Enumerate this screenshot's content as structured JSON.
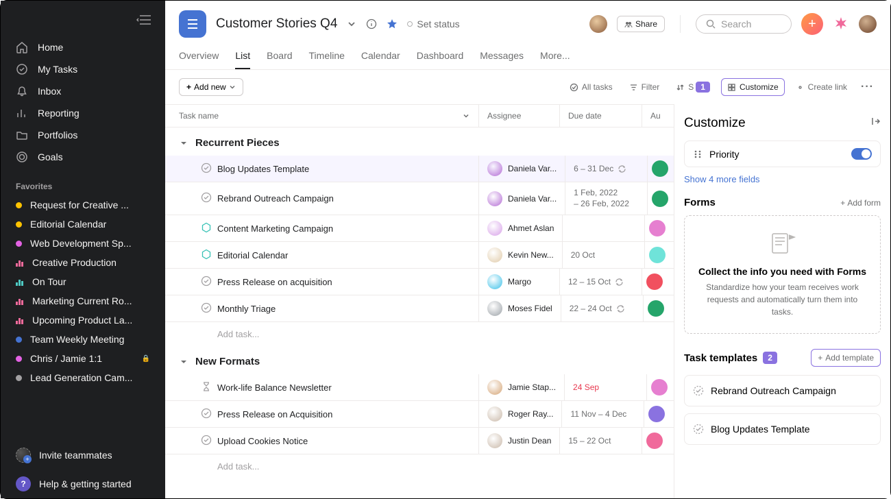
{
  "sidebar": {
    "nav": [
      {
        "icon": "home",
        "label": "Home"
      },
      {
        "icon": "check",
        "label": "My Tasks"
      },
      {
        "icon": "bell",
        "label": "Inbox"
      },
      {
        "icon": "chart",
        "label": "Reporting"
      },
      {
        "icon": "folder",
        "label": "Portfolios"
      },
      {
        "icon": "target",
        "label": "Goals"
      }
    ],
    "favorites_label": "Favorites",
    "favorites": [
      {
        "type": "dot",
        "color": "#fec300",
        "label": "Request for Creative ..."
      },
      {
        "type": "dot",
        "color": "#fec300",
        "label": "Editorial Calendar"
      },
      {
        "type": "dot",
        "color": "#e362e3",
        "label": "Web Development Sp..."
      },
      {
        "type": "bars",
        "color": "#f06a9b",
        "label": "Creative Production"
      },
      {
        "type": "bars",
        "color": "#4ecbc4",
        "label": "On Tour"
      },
      {
        "type": "bars",
        "color": "#f06a9b",
        "label": "Marketing Current Ro..."
      },
      {
        "type": "bars",
        "color": "#f06a9b",
        "label": "Upcoming Product La..."
      },
      {
        "type": "dot",
        "color": "#4573d2",
        "label": "Team Weekly Meeting"
      },
      {
        "type": "dot",
        "color": "#e362e3",
        "label": "Chris / Jamie 1:1",
        "locked": true
      },
      {
        "type": "dot",
        "color": "#a2a0a2",
        "label": "Lead Generation Cam..."
      }
    ],
    "invite_label": "Invite teammates",
    "help_label": "Help & getting started"
  },
  "header": {
    "title": "Customer Stories Q4",
    "set_status": "Set status",
    "share": "Share",
    "search_placeholder": "Search"
  },
  "tabs": [
    "Overview",
    "List",
    "Board",
    "Timeline",
    "Calendar",
    "Dashboard",
    "Messages",
    "More..."
  ],
  "active_tab": 1,
  "toolbar": {
    "add_new": "Add new",
    "all_tasks": "All tasks",
    "filter": "Filter",
    "sort_badge": "1",
    "customize": "Customize",
    "create_link": "Create link"
  },
  "columns": {
    "task": "Task name",
    "assignee": "Assignee",
    "due": "Due date",
    "au": "Au"
  },
  "sections": [
    {
      "title": "Recurrent Pieces",
      "add_task": "Add task...",
      "rows": [
        {
          "name": "Blog Updates Template",
          "bold": true,
          "hl": true,
          "check": "circle",
          "assignee": {
            "name": "Daniela Var...",
            "color": "#b36bd4"
          },
          "due": "6 – 31 Dec",
          "recur": true,
          "au": "#25a56a"
        },
        {
          "name": "Rebrand Outreach Campaign",
          "check": "circle",
          "assignee": {
            "name": "Daniela Var...",
            "color": "#b36bd4"
          },
          "due": "1 Feb, 2022 – 26 Feb, 2022",
          "stack": true,
          "au": "#25a56a"
        },
        {
          "name": "Content Marketing Campaign",
          "bold": true,
          "check": "hex",
          "assignee": {
            "name": "Ahmet Aslan",
            "color": "#d7a0e8"
          },
          "due": "",
          "au": "#e67fd0"
        },
        {
          "name": "Editorial Calendar",
          "bold": true,
          "check": "hex",
          "assignee": {
            "name": "Kevin New...",
            "color": "#e0caa8"
          },
          "due": "20 Oct",
          "au": "#6fe3d9"
        },
        {
          "name": "Press Release on acquisition",
          "check": "circle",
          "assignee": {
            "name": "Margo",
            "color": "#3ac0e8"
          },
          "due": "12 – 15 Oct",
          "recur": true,
          "au": "#f1505f"
        },
        {
          "name": "Monthly Triage",
          "check": "circle",
          "assignee": {
            "name": "Moses Fidel",
            "color": "#9aa0a6"
          },
          "due": "22 – 24 Oct",
          "recur": true,
          "au": "#25a56a"
        }
      ]
    },
    {
      "title": "New Formats",
      "add_task": "Add task...",
      "rows": [
        {
          "name": "Work-life Balance Newsletter",
          "check": "hourglass",
          "assignee": {
            "name": "Jamie Stap...",
            "color": "#d4a373"
          },
          "due": "24 Sep",
          "overdue": true,
          "au": "#e67fd0"
        },
        {
          "name": "Press Release on Acquisition",
          "check": "circle",
          "assignee": {
            "name": "Roger Ray...",
            "color": "#c9b8a8"
          },
          "due": "11 Nov – 4 Dec",
          "au": "#8a72e0"
        },
        {
          "name": "Upload Cookies Notice",
          "check": "circle",
          "assignee": {
            "name": "Justin Dean",
            "color": "#c9b8a8"
          },
          "due": "15 – 22 Oct",
          "au": "#f06a9b"
        }
      ]
    }
  ],
  "panel": {
    "title": "Customize",
    "field_name": "Priority",
    "show_more": "Show 4 more fields",
    "forms": {
      "title": "Forms",
      "add": "Add form",
      "card_title": "Collect the info you need with Forms",
      "card_desc": "Standardize how your team receives work requests and automatically turn them into tasks."
    },
    "templates": {
      "title": "Task templates",
      "badge": "2",
      "add": "Add template",
      "items": [
        "Rebrand Outreach Campaign",
        "Blog Updates Template"
      ]
    }
  }
}
